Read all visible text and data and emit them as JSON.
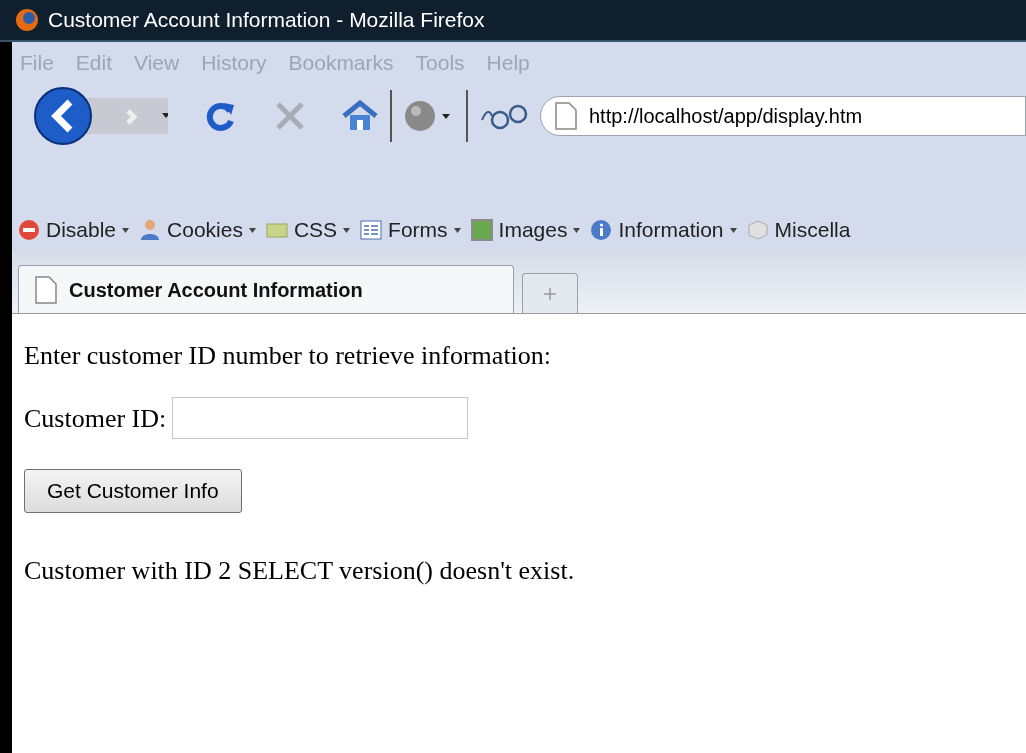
{
  "window": {
    "title": "Customer Account Information - Mozilla Firefox"
  },
  "menu": [
    "File",
    "Edit",
    "View",
    "History",
    "Bookmarks",
    "Tools",
    "Help"
  ],
  "address_bar": {
    "value": "http://localhost/app/display.htm"
  },
  "dev_toolbar": [
    {
      "kind": "disable",
      "label": "Disable"
    },
    {
      "kind": "cookies",
      "label": "Cookies"
    },
    {
      "kind": "css",
      "label": "CSS"
    },
    {
      "kind": "forms",
      "label": "Forms"
    },
    {
      "kind": "images",
      "label": "Images"
    },
    {
      "kind": "information",
      "label": "Information"
    },
    {
      "kind": "misc",
      "label": "Miscella"
    }
  ],
  "tabs": [
    {
      "label": "Customer Account Information",
      "selected": true
    }
  ],
  "page": {
    "intro": "Enter customer ID number to retrieve information:",
    "field_label": "Customer ID:",
    "button": "Get Customer Info",
    "message": "Customer with ID 2 SELECT version() doesn't exist."
  }
}
